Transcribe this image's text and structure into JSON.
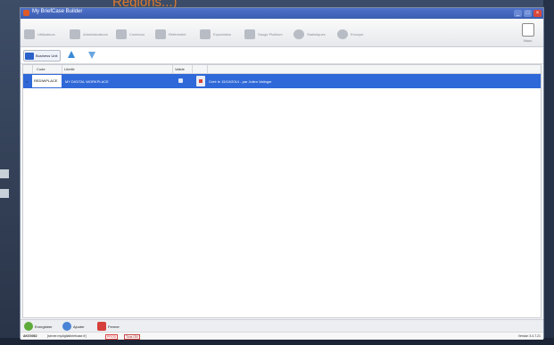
{
  "slide": {
    "caption": "Regions...)"
  },
  "window": {
    "title": "My BriefCase Builder",
    "controls": {
      "minimize": "_",
      "maximize": "□",
      "close": "×"
    }
  },
  "nav": {
    "items": [
      {
        "label": "Utilisateurs",
        "icon": "users-icon"
      },
      {
        "label": "Administrateurs",
        "icon": "share-icon"
      },
      {
        "label": "Contenus",
        "icon": "document-icon"
      },
      {
        "label": "Référentiel",
        "icon": "grid-icon"
      },
      {
        "label": "Exportation",
        "icon": "export-icon"
      },
      {
        "label": "Sauge Platform",
        "icon": "settings-icon"
      },
      {
        "label": "Statistiques",
        "icon": "chart-icon"
      },
      {
        "label": "Envoyer",
        "icon": "send-icon"
      }
    ],
    "new_label": "Nouv."
  },
  "toolbar": {
    "business_unit_label": "Business Unit",
    "move_up_icon": "arrow-up-icon",
    "move_down_icon": "arrow-down-icon"
  },
  "grid": {
    "columns": [
      "Code",
      "Libellé",
      "Valide",
      ""
    ],
    "rows": [
      {
        "marker": ">",
        "code": "REDIWPLACE",
        "label": "MY DIGITAL WORKPLACE",
        "detail": "Créé le 15/10/2014 - par Julien Vatinger"
      }
    ]
  },
  "actions": {
    "save": "Enregistrer",
    "add": "Ajouter",
    "close": "Fermer"
  },
  "status": {
    "user": "AKG0062",
    "server": "[server.mydigitalbriefcase.fr]",
    "env": "PROD",
    "user_badge": "Tous ON",
    "version": "Version 3.4.7.21"
  }
}
